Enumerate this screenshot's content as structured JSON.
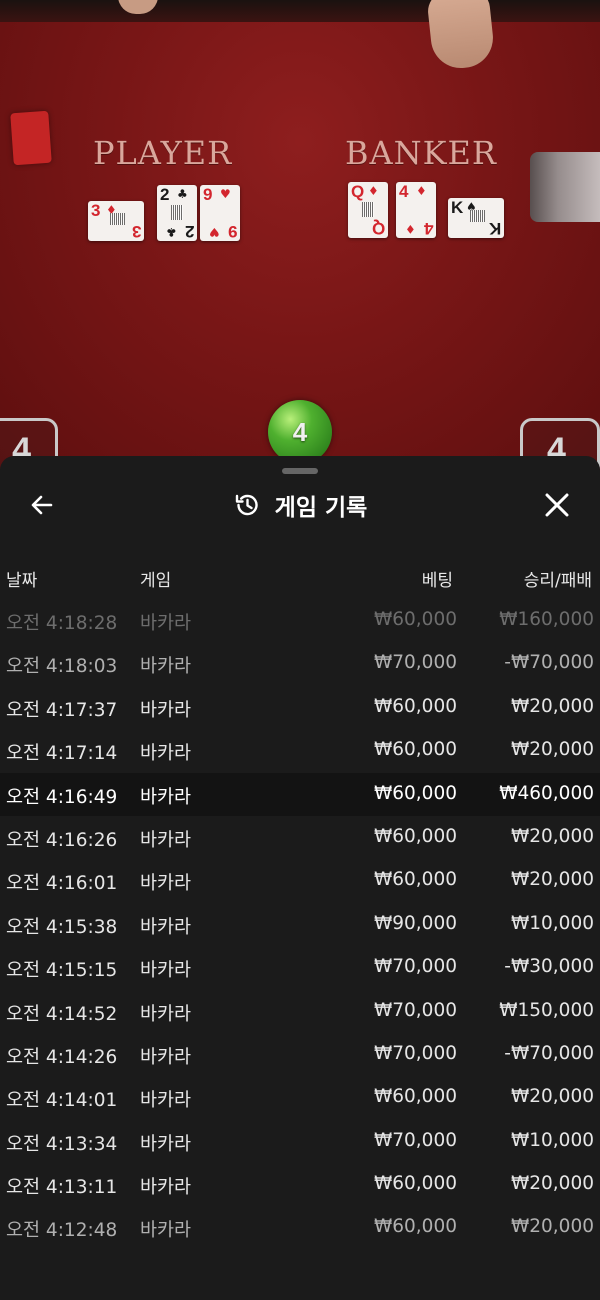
{
  "table": {
    "player_label": "PLAYER",
    "banker_label": "BANKER",
    "player_cards": [
      {
        "rank": "3",
        "suit": "♦",
        "color": "red"
      },
      {
        "rank": "2",
        "suit": "♣",
        "color": "black"
      },
      {
        "rank": "9",
        "suit": "♥",
        "color": "red"
      }
    ],
    "banker_cards": [
      {
        "rank": "Q",
        "suit": "♦",
        "color": "red"
      },
      {
        "rank": "4",
        "suit": "♦",
        "color": "red"
      },
      {
        "rank": "K",
        "suit": "♠",
        "color": "black"
      }
    ],
    "center_score": "4",
    "left_score": "4",
    "right_score": "4"
  },
  "sheet": {
    "title": "게임 기록",
    "back_icon": "arrow-left-icon",
    "history_icon": "history-icon",
    "close_icon": "close-icon",
    "columns": {
      "date": "날짜",
      "game": "게임",
      "bet": "베팅",
      "result": "승리/패배"
    },
    "rows": [
      {
        "time": "오전 4:18:28",
        "game": "바카라",
        "bet": "₩60,000",
        "result": "₩160,000",
        "style": "dim"
      },
      {
        "time": "오전 4:18:03",
        "game": "바카라",
        "bet": "₩70,000",
        "result": "-₩70,000",
        "style": "mid"
      },
      {
        "time": "오전 4:17:37",
        "game": "바카라",
        "bet": "₩60,000",
        "result": "₩20,000",
        "style": ""
      },
      {
        "time": "오전 4:17:14",
        "game": "바카라",
        "bet": "₩60,000",
        "result": "₩20,000",
        "style": ""
      },
      {
        "time": "오전 4:16:49",
        "game": "바카라",
        "bet": "₩60,000",
        "result": "₩460,000",
        "style": "hl"
      },
      {
        "time": "오전 4:16:26",
        "game": "바카라",
        "bet": "₩60,000",
        "result": "₩20,000",
        "style": ""
      },
      {
        "time": "오전 4:16:01",
        "game": "바카라",
        "bet": "₩60,000",
        "result": "₩20,000",
        "style": ""
      },
      {
        "time": "오전 4:15:38",
        "game": "바카라",
        "bet": "₩90,000",
        "result": "₩10,000",
        "style": ""
      },
      {
        "time": "오전 4:15:15",
        "game": "바카라",
        "bet": "₩70,000",
        "result": "-₩30,000",
        "style": ""
      },
      {
        "time": "오전 4:14:52",
        "game": "바카라",
        "bet": "₩70,000",
        "result": "₩150,000",
        "style": ""
      },
      {
        "time": "오전 4:14:26",
        "game": "바카라",
        "bet": "₩70,000",
        "result": "-₩70,000",
        "style": ""
      },
      {
        "time": "오전 4:14:01",
        "game": "바카라",
        "bet": "₩60,000",
        "result": "₩20,000",
        "style": ""
      },
      {
        "time": "오전 4:13:34",
        "game": "바카라",
        "bet": "₩70,000",
        "result": "₩10,000",
        "style": ""
      },
      {
        "time": "오전 4:13:11",
        "game": "바카라",
        "bet": "₩60,000",
        "result": "₩20,000",
        "style": ""
      },
      {
        "time": "오전 4:12:48",
        "game": "바카라",
        "bet": "₩60,000",
        "result": "₩20,000",
        "style": "mid"
      }
    ]
  },
  "colors": {
    "table_red": "#7a1616",
    "sheet_bg": "#1b1b1b",
    "highlight_row": "#131313",
    "score_ball": "#4fb02f",
    "card_red": "#d3262e"
  }
}
